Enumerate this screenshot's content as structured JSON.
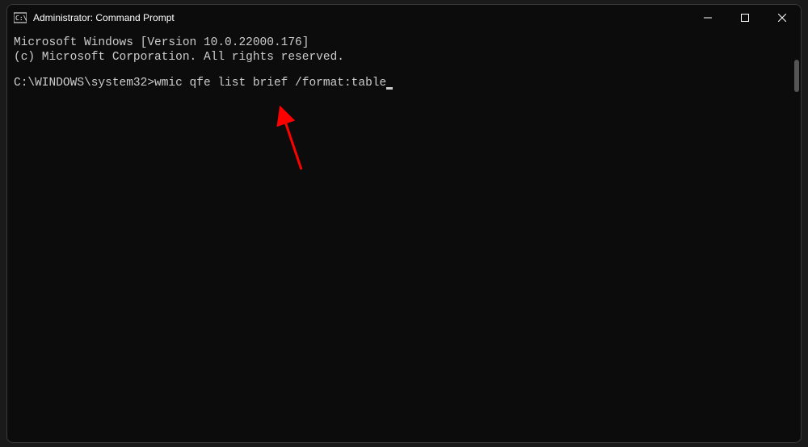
{
  "window": {
    "title": "Administrator: Command Prompt"
  },
  "terminal": {
    "line1": "Microsoft Windows [Version 10.0.22000.176]",
    "line2": "(c) Microsoft Corporation. All rights reserved.",
    "prompt": "C:\\WINDOWS\\system32>",
    "command": "wmic qfe list brief /format:table"
  },
  "annotation": {
    "arrow_color": "#ff0000"
  }
}
